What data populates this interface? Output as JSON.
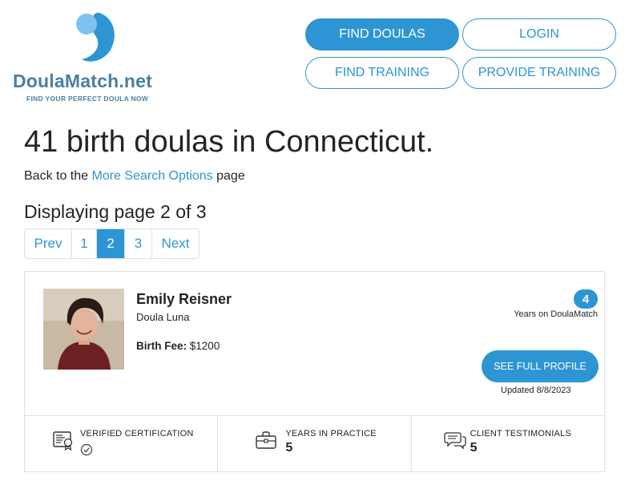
{
  "brand": {
    "name": "DoulaMatch",
    "tld": ".net",
    "tagline": "FIND YOUR PERFECT DOULA NOW",
    "color": "#4b7fa3",
    "logo_icon": "doula-drop-logo-icon"
  },
  "nav": {
    "find_doulas": "FIND DOULAS",
    "login": "LOGIN",
    "find_training": "FIND TRAINING",
    "provide_training": "PROVIDE TRAINING"
  },
  "colors": {
    "accent": "#2d95d4",
    "text": "#212529",
    "border": "#dee2e6"
  },
  "page": {
    "title": "41 birth doulas in Connecticut.",
    "back_prefix": "Back to the ",
    "back_link": "More Search Options",
    "back_suffix": " page",
    "page_indicator": "Displaying page 2 of 3"
  },
  "pagination": {
    "prev": "Prev",
    "pages": [
      "1",
      "2",
      "3"
    ],
    "active": "2",
    "next": "Next"
  },
  "profile": {
    "name": "Emily Reisner",
    "organization": "Doula Luna",
    "fee_label": "Birth Fee:",
    "fee_value": "$1200",
    "years_on_site": "4",
    "years_on_site_label": "Years on DoulaMatch",
    "button": "SEE FULL PROFILE",
    "updated": "Updated 8/8/2023",
    "stats": {
      "certification_label": "VERIFIED CERTIFICATION",
      "certification_icon": "check-circle-icon",
      "years_label": "YEARS IN PRACTICE",
      "years_value": "5",
      "testimonials_label": "CLIENT TESTIMONIALS",
      "testimonials_value": "5"
    }
  }
}
